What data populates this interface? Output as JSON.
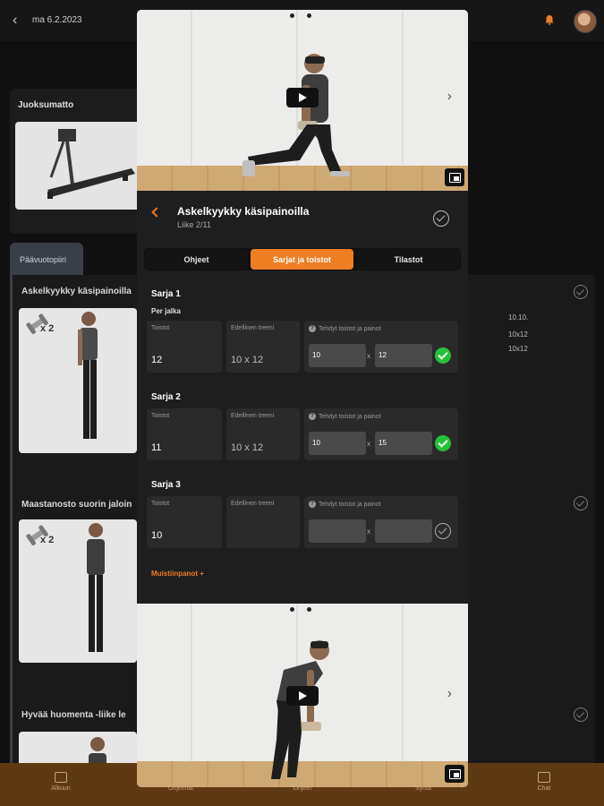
{
  "background": {
    "header": {
      "date": "ma 6.2.2023"
    },
    "card": {
      "title": "Juoksumatto"
    },
    "tab": {
      "label": "Päävuotopiiri"
    },
    "exercises": [
      {
        "title": "Askelkyykky käsipainoilla",
        "multiplier": "x 2"
      },
      {
        "title": "Maastanosto suorin jaloin",
        "multiplier": "x 2"
      },
      {
        "title": "Hyvää huomenta -liike le"
      }
    ],
    "stats": {
      "date": "10.10.",
      "rows": [
        "10x12",
        "10x12"
      ]
    },
    "bottom_nav": [
      "Alkuun",
      "Ohjelmat",
      "Ohjeet",
      "Syötä",
      "Chat"
    ]
  },
  "modal": {
    "exercise": {
      "title": "Askelkyykky käsipainoilla",
      "subtitle": "Liike 2/11"
    },
    "tabs": [
      {
        "label": "Ohjeet",
        "active": false
      },
      {
        "label": "Sarjat ja toistot",
        "active": true
      },
      {
        "label": "Tilastot",
        "active": false
      }
    ],
    "per_side": "Per jalka",
    "labels": {
      "reps": "Toistot",
      "previous": "Edellinen treeni",
      "done": "Tehdyt toistot ja painot",
      "x": "x"
    },
    "sets": [
      {
        "title": "Sarja 1",
        "reps": "12",
        "previous": "10 x 12",
        "done_reps": "10",
        "done_weight": "12",
        "completed": true
      },
      {
        "title": "Sarja 2",
        "reps": "11",
        "previous": "10 x 12",
        "done_reps": "10",
        "done_weight": "15",
        "completed": true
      },
      {
        "title": "Sarja 3",
        "reps": "10",
        "previous": "",
        "done_reps": "",
        "done_weight": "",
        "completed": false
      }
    ],
    "notes_link": "Muistiinpanot +"
  },
  "icons": {
    "back": "back-arrow-icon",
    "play": "play-icon",
    "next": "chevron-right-icon",
    "pip": "picture-in-picture-icon",
    "check": "check-circle-icon",
    "help": "help-icon",
    "bell": "bell-icon"
  },
  "colors": {
    "accent": "#ef7d22",
    "success": "#23c23a",
    "nav_bg": "#5e3a13"
  }
}
